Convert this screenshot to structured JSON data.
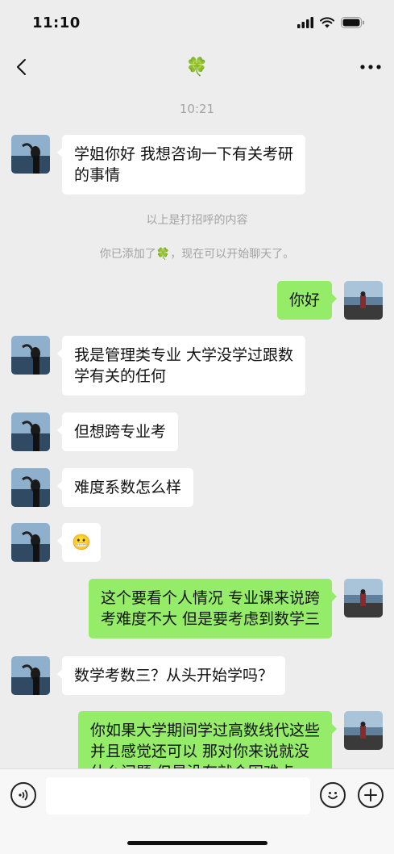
{
  "status": {
    "time": "11:10"
  },
  "nav": {
    "title_glyph": "🍀",
    "back_icon": "chevron-left-icon",
    "more_icon": "more-icon"
  },
  "chat": {
    "timestamp": "10:21",
    "system_greeting": "以上是打招呼的内容",
    "system_added_prefix": "你已添加了",
    "system_added_glyph": "🍀",
    "system_added_suffix": "，现在可以开始聊天了。",
    "messages": [
      {
        "side": "left",
        "text": "学姐你好 我想咨询一下有关考研\n的事情"
      },
      {
        "side": "right",
        "text": "你好"
      },
      {
        "side": "left",
        "text": "我是管理类专业 大学没学过跟数\n学有关的任何"
      },
      {
        "side": "left",
        "text": "但想跨专业考"
      },
      {
        "side": "left",
        "text": "难度系数怎么样"
      },
      {
        "side": "left",
        "text": "😬"
      },
      {
        "side": "right",
        "text": "这个要看个人情况 专业课来说跨\n考难度不大 但是要考虑到数学三"
      },
      {
        "side": "left",
        "text": "数学考数三？从头开始学吗？"
      },
      {
        "side": "right",
        "text": "你如果大学期间学过高数线代这些\n并且感觉还可以 那对你来说就没\n什么问题 但是没有就会困难点"
      }
    ]
  },
  "input": {
    "placeholder": ""
  },
  "colors": {
    "background": "#ededed",
    "bubble_sent": "#95ec69",
    "bubble_received": "#ffffff"
  }
}
